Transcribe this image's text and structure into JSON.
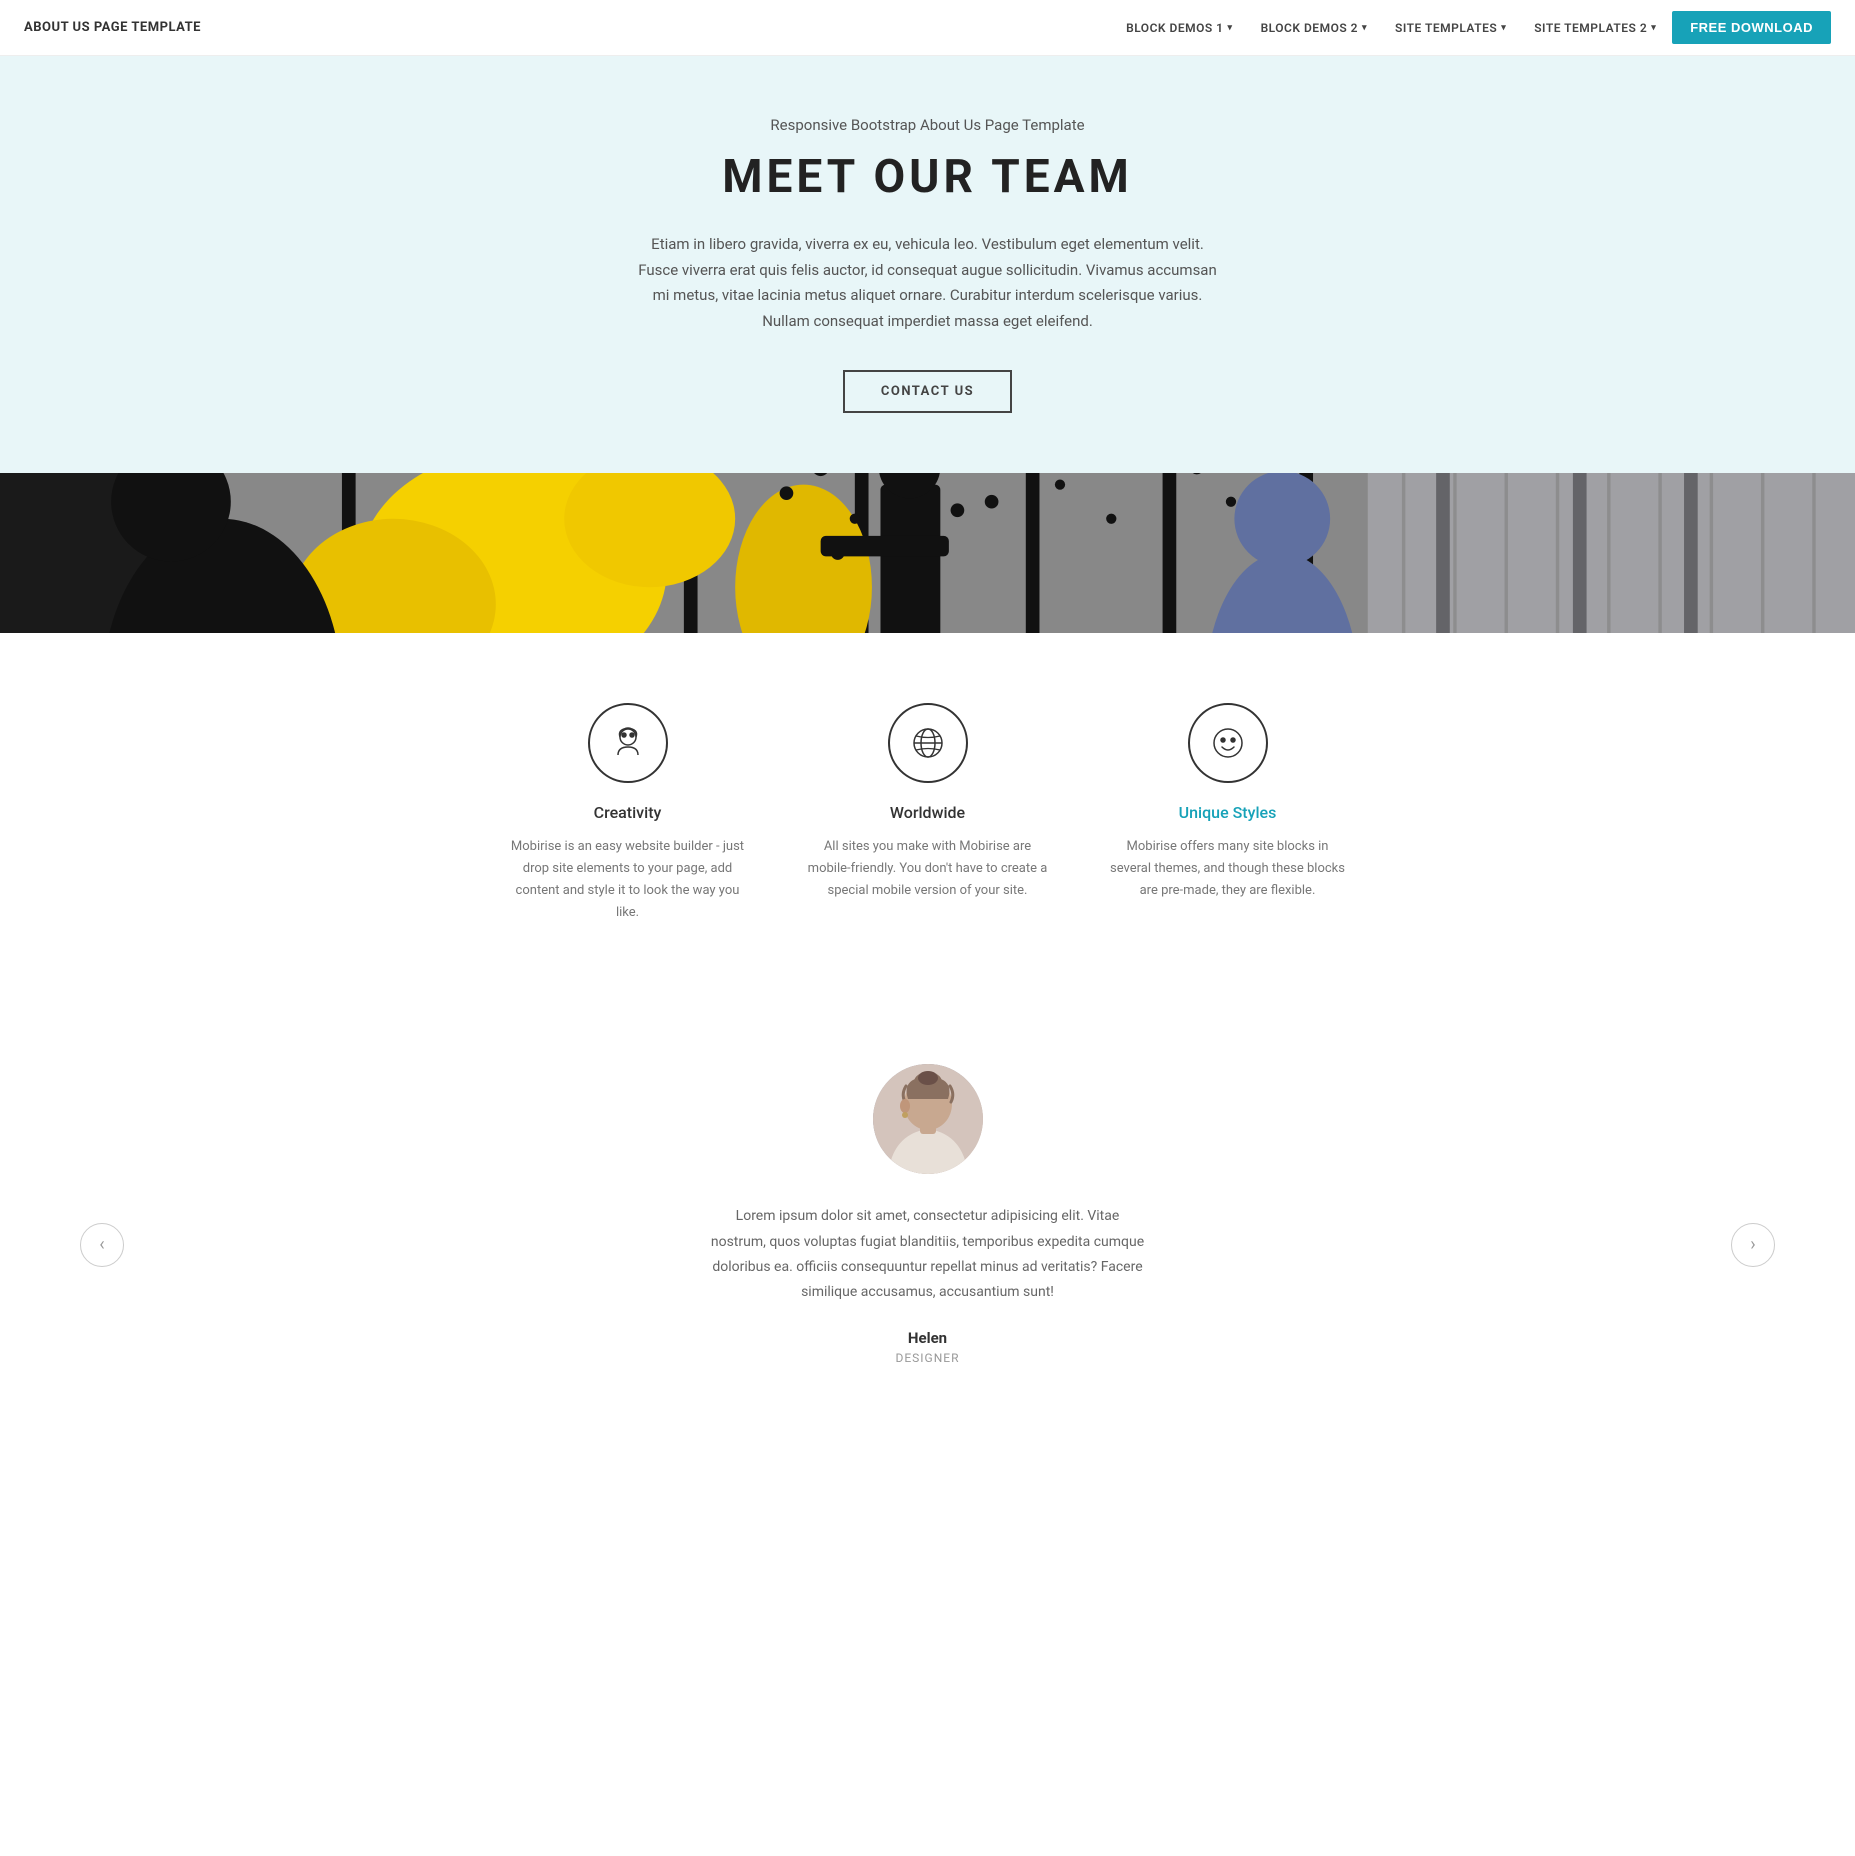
{
  "navbar": {
    "brand": "ABOUT US PAGE TEMPLATE",
    "nav_items": [
      {
        "label": "BLOCK DEMOS 1",
        "has_dropdown": true
      },
      {
        "label": "BLOCK DEMOS 2",
        "has_dropdown": true
      },
      {
        "label": "SITE TEMPLATES",
        "has_dropdown": true
      },
      {
        "label": "SITE TEMPLATES 2",
        "has_dropdown": true
      }
    ],
    "cta_label": "FREE DOWNLOAD"
  },
  "hero": {
    "subtitle": "Responsive Bootstrap About Us Page Template",
    "title": "MEET OUR TEAM",
    "body_text": "Etiam in libero gravida, viverra ex eu, vehicula leo. Vestibulum eget elementum velit. Fusce viverra erat quis felis auctor, id consequat augue sollicitudin. Vivamus accumsan mi metus, vitae lacinia metus aliquet ornare. Curabitur interdum scelerisque varius. Nullam consequat imperdiet massa eget eleifend.",
    "cta_label": "CONTACT US"
  },
  "features": {
    "items": [
      {
        "icon": "creativity",
        "title": "Creativity",
        "desc": "Mobirise is an easy website builder - just drop site elements to your page, add content and style it to look the way you like.",
        "highlight": false
      },
      {
        "icon": "worldwide",
        "title": "Worldwide",
        "desc": "All sites you make with Mobirise are mobile-friendly. You don't have to create a special mobile version of your site.",
        "highlight": false
      },
      {
        "icon": "unique-styles",
        "title": "Unique Styles",
        "desc": "Mobirise offers many site blocks in several themes, and though these blocks are pre-made, they are flexible.",
        "highlight": true
      }
    ]
  },
  "testimonial": {
    "quote": "Lorem ipsum dolor sit amet, consectetur adipisicing elit. Vitae nostrum, quos voluptas fugiat blanditiis, temporibus expedita cumque doloribus ea. officiis consequuntur repellat minus ad veritatis? Facere similique accusamus, accusantium sunt!",
    "name": "Helen",
    "role": "DESIGNER",
    "arrow_left": "‹",
    "arrow_right": "›"
  }
}
